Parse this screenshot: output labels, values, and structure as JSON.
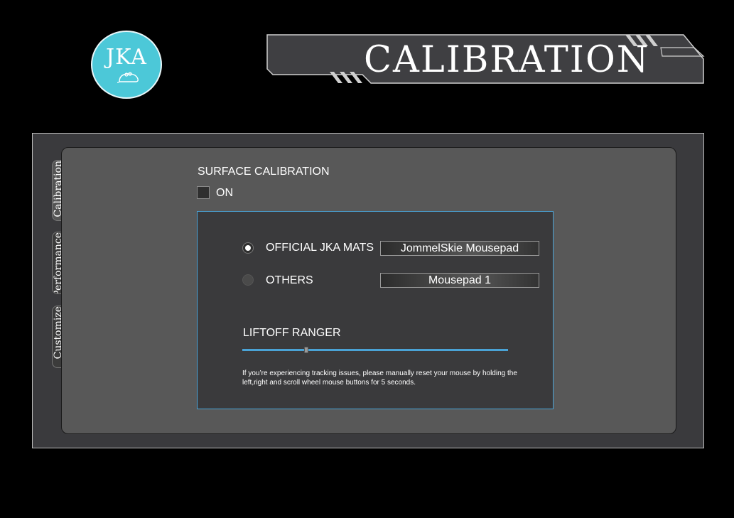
{
  "logo": {
    "text": "JKA",
    "icon": "mouse-icon"
  },
  "header": {
    "title": "CALIBRATION"
  },
  "tabs": [
    {
      "label": "Calibration",
      "active": true
    },
    {
      "label": "Performance",
      "active": false
    },
    {
      "label": "Customize",
      "active": false
    }
  ],
  "surface": {
    "title": "SURFACE CALIBRATION",
    "toggle_label": "ON",
    "toggle_checked": false
  },
  "options": [
    {
      "label": "OFFICIAL JKA MATS",
      "selected": true,
      "value": "JommelSkie Mousepad"
    },
    {
      "label": "OTHERS",
      "selected": false,
      "value": "Mousepad 1"
    }
  ],
  "liftoff": {
    "title": "LIFTOFF RANGER",
    "level": 0.24,
    "note": "If you’re experiencing tracking issues, please manually reset your mouse by holding the left,right and scroll wheel mouse buttons for 5 seconds."
  },
  "colors": {
    "accent": "#4aa3d6",
    "logo": "#4cc8d8",
    "panel": "#585858"
  }
}
